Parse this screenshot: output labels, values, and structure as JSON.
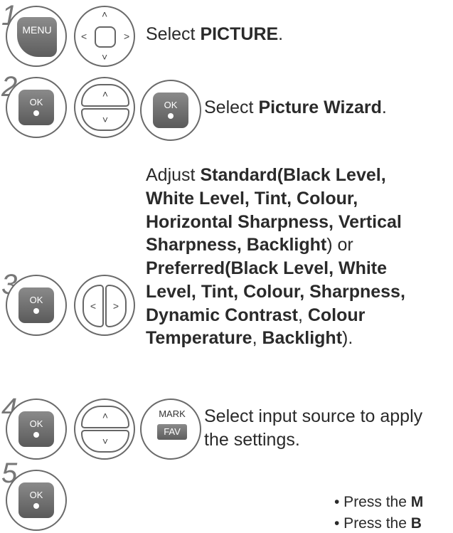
{
  "steps": [
    {
      "num": "1",
      "keys": {
        "menu": "MENU"
      },
      "text": {
        "prefix": "Select ",
        "bold": "PICTURE",
        "suffix": "."
      }
    },
    {
      "num": "2",
      "keys": {
        "ok1": "OK",
        "ok2": "OK"
      },
      "text": {
        "prefix": "Select ",
        "bold": "Picture Wizard",
        "suffix": "."
      }
    },
    {
      "num": "3",
      "keys": {
        "ok": "OK"
      }
    },
    {
      "num": "4",
      "keys": {
        "ok": "OK",
        "mark": "MARK",
        "fav": "FAV"
      },
      "text": {
        "line1": "Select input source to apply",
        "line2": "the settings."
      }
    },
    {
      "num": "5",
      "keys": {
        "ok": "OK"
      }
    }
  ],
  "step3_text": {
    "a": "Adjust ",
    "b": "Standard(Black Level,",
    "c": "White Level, Tint, Colour,",
    "d": "Horizontal Sharpness, Vertical",
    "e": "Sharpness, Backlight",
    "f": ") or",
    "g": "Preferred(Black Level, White",
    "h": "Level, Tint, Colour, Sharpness,",
    "i": "Dynamic Contrast",
    "j": ", ",
    "k": "Colour",
    "l": "Temperature",
    "m": ", ",
    "n": "Backlight",
    "o": ")."
  },
  "bullets": [
    {
      "prefix": "• Press the ",
      "bold": "M"
    },
    {
      "prefix": "• Press the ",
      "bold": "B"
    }
  ]
}
